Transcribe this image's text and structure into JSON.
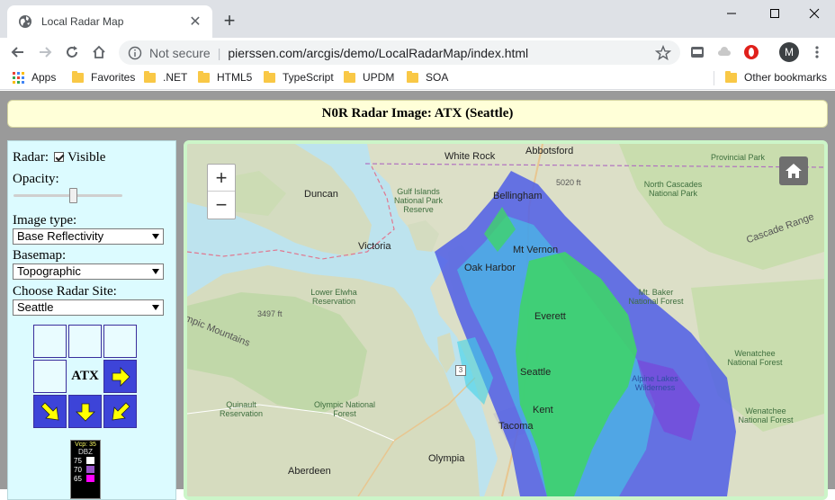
{
  "browser": {
    "tab_title": "Local Radar Map",
    "security_label": "Not secure",
    "url": "pierssen.com/arcgis/demo/LocalRadarMap/index.html",
    "avatar_letter": "M",
    "bookmarks": [
      "Apps",
      "Favorites",
      ".NET",
      "HTML5",
      "TypeScript",
      "UPDM",
      "SOA"
    ],
    "other_bookmarks": "Other bookmarks"
  },
  "page": {
    "header": "N0R Radar Image: ATX (Seattle)"
  },
  "controls": {
    "radar_label": "Radar:",
    "visible_label": "Visible",
    "visible_checked": true,
    "opacity_label": "Opacity:",
    "opacity_value": 0.55,
    "image_type_label": "Image type:",
    "image_type_value": "Base Reflectivity",
    "basemap_label": "Basemap:",
    "basemap_value": "Topographic",
    "site_label": "Choose Radar Site:",
    "site_value": "Seattle",
    "site_code": "ATX"
  },
  "legend": {
    "title": "Vcp: 35",
    "unit": "DBZ",
    "entries": [
      {
        "value": "75",
        "color": "#ffffff"
      },
      {
        "value": "70",
        "color": "#9955c9"
      },
      {
        "value": "65",
        "color": "#ff00ff"
      }
    ]
  },
  "map": {
    "labels": {
      "white_rock": "White Rock",
      "abbotsford": "Abbotsford",
      "bellingham": "Bellingham",
      "duncan": "Duncan",
      "gulf_islands": "Gulf Islands National Park Reserve",
      "victoria": "Victoria",
      "mt_vernon": "Mt Vernon",
      "oak_harbor": "Oak Harbor",
      "lower_elwha": "Lower Elwha Reservation",
      "olympic_mountains": "mpic Mountains",
      "elev_3497": "3497 ft",
      "everett": "Everett",
      "seattle": "Seattle",
      "kent": "Kent",
      "tacoma": "Tacoma",
      "olympia": "Olympia",
      "aberdeen": "Aberdeen",
      "quinault": "Quinault Reservation",
      "olympic_nf": "Olympic National Forest",
      "north_cascades": "North Cascades National Park",
      "cascade_range": "Cascade Range",
      "mt_baker": "Mt. Baker National Forest",
      "wenatchee": "Wenatchee National Forest",
      "alpine_lakes": "Alpine Lakes Wilderness",
      "provincial_park": "Provincial Park",
      "elev_5020": "5020 ft",
      "route_3": "3"
    }
  },
  "colors": {
    "page_bg": "#9a9a9a",
    "header_bg": "#ffffd8",
    "sidebar_bg": "#dcfbff",
    "button_blue": "#3d44d8",
    "arrow_yellow": "#ffff00",
    "radar_green": "#3ed46a",
    "radar_blue": "#4f5ee6",
    "radar_cyan": "#3fd2e8",
    "water": "#bde3ee",
    "land": "#dcdfc7"
  },
  "icons": [
    "globe-icon",
    "close-icon",
    "plus-icon",
    "back-icon",
    "forward-icon",
    "reload-icon",
    "home-icon",
    "info-icon",
    "star-icon",
    "menu-icon",
    "zoom-in-icon",
    "zoom-out-icon",
    "map-home-icon",
    "arrow-right-icon",
    "arrow-down-left-icon",
    "arrow-down-icon",
    "arrow-up-left-icon"
  ]
}
